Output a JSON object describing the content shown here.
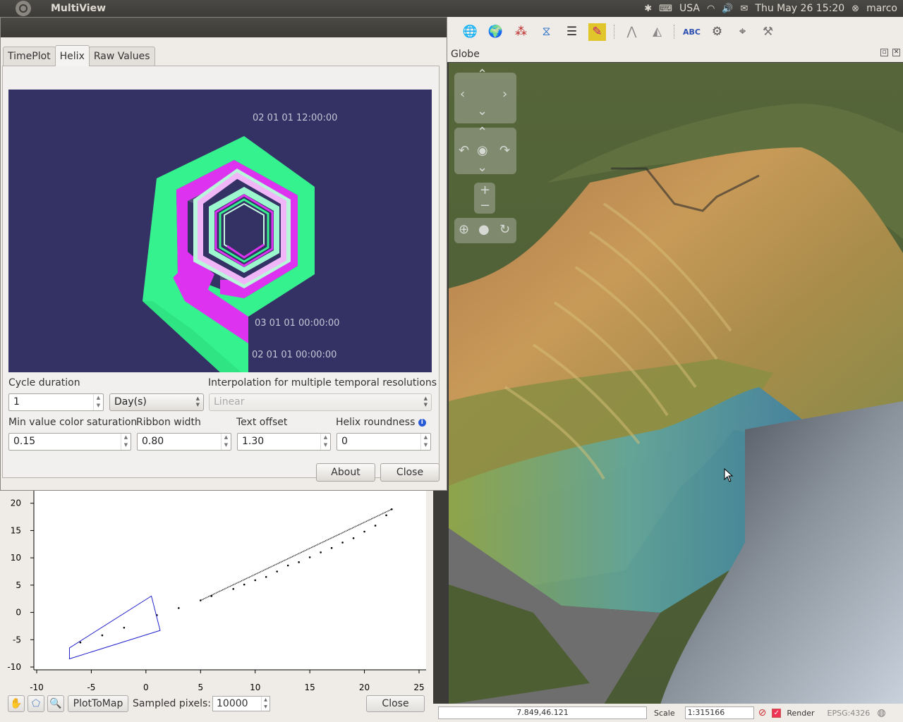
{
  "topbar": {
    "app_title": "MultiView",
    "keyboard_layout": "USA",
    "datetime": "Thu May 26 15:20",
    "user": "marco"
  },
  "globe": {
    "title": "Globe"
  },
  "statusbar": {
    "coordinates": "7.849,46.121",
    "scale_label": "Scale",
    "scale_value": "1:315166",
    "render_label": "Render",
    "crs": "EPSG:4326"
  },
  "dialog": {
    "tabs": [
      {
        "label": "TimePlot"
      },
      {
        "label": "Helix"
      },
      {
        "label": "Raw Values"
      }
    ],
    "helix_labels": {
      "top": "02 01 01 12:00:00",
      "mid": "03 01 01 00:00:00",
      "bottom": "02 01 01 00:00:00"
    },
    "cycle_duration_label": "Cycle duration",
    "cycle_duration_value": "1",
    "cycle_unit": "Day(s)",
    "interpolation_label": "Interpolation for multiple temporal resolutions",
    "interpolation_value": "Linear",
    "min_saturation_label": "Min value color saturation",
    "min_saturation_value": "0.15",
    "ribbon_width_label": "Ribbon width",
    "ribbon_width_value": "0.80",
    "text_offset_label": "Text offset",
    "text_offset_value": "1.30",
    "helix_roundness_label": "Helix roundness",
    "helix_roundness_value": "0",
    "about_button": "About",
    "close_button": "Close"
  },
  "scatter": {
    "plot_to_map_button": "PlotToMap",
    "sampled_pixels_label": "Sampled pixels:",
    "sampled_pixels_value": "10000",
    "close_button": "Close"
  },
  "chart_data": {
    "type": "scatter",
    "x_ticks": [
      "-10",
      "-5",
      "0",
      "5",
      "10",
      "15",
      "20",
      "25"
    ],
    "y_ticks": [
      "20",
      "15",
      "10",
      "5",
      "0",
      "-5",
      "-10"
    ],
    "xlim": [
      -10,
      25
    ],
    "ylim": [
      -10,
      21
    ],
    "points": [
      [
        -6,
        -5.5
      ],
      [
        -4,
        -4.2
      ],
      [
        -2,
        -2.8
      ],
      [
        1,
        -0.5
      ],
      [
        3,
        0.8
      ],
      [
        5,
        2.2
      ],
      [
        6,
        3
      ],
      [
        8,
        4.3
      ],
      [
        9,
        5.1
      ],
      [
        10,
        5.9
      ],
      [
        11,
        6.5
      ],
      [
        12,
        7.5
      ],
      [
        13,
        8.6
      ],
      [
        14,
        9.2
      ],
      [
        15,
        10.1
      ],
      [
        16,
        11
      ],
      [
        17,
        11.8
      ],
      [
        18,
        12.8
      ],
      [
        19,
        13.6
      ],
      [
        20,
        14.8
      ],
      [
        21,
        15.9
      ],
      [
        22,
        17.8
      ],
      [
        22.5,
        18.9
      ]
    ],
    "selection_polygon": [
      [
        -7,
        -6.5
      ],
      [
        0.5,
        3
      ],
      [
        1.3,
        -3.3
      ],
      [
        -7,
        -8.5
      ]
    ]
  }
}
